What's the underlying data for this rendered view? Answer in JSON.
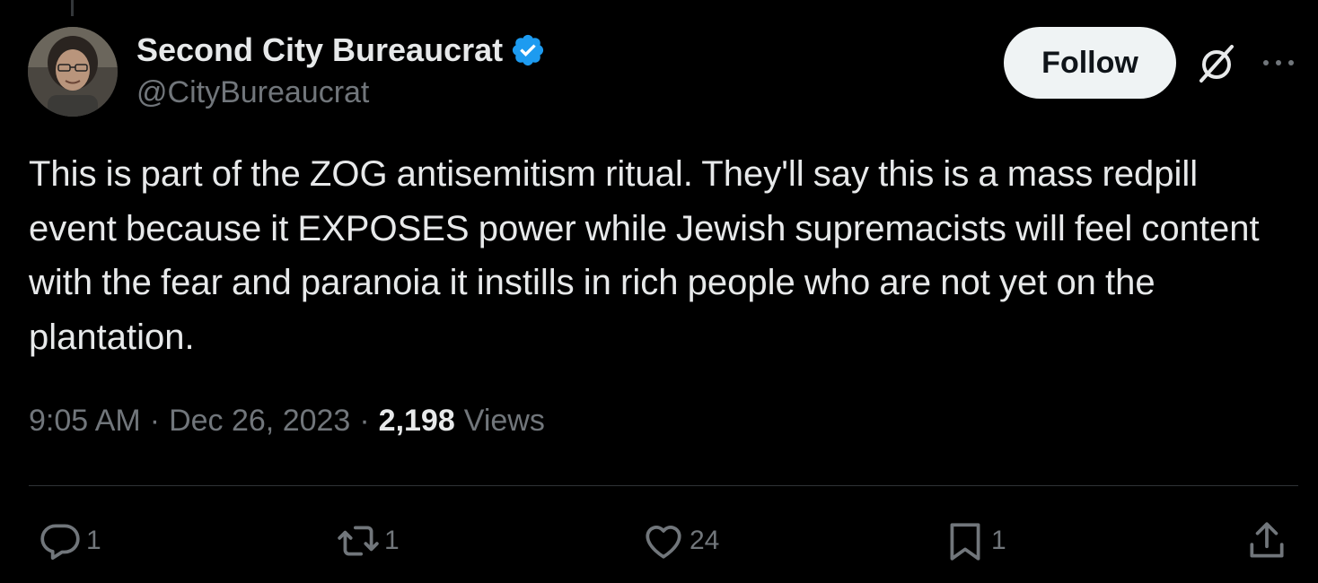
{
  "user": {
    "display_name": "Second City Bureaucrat",
    "handle": "@CityBureaucrat",
    "verified": true,
    "avatar_icon": "profile-photo"
  },
  "header": {
    "follow_label": "Follow",
    "grok_icon": "grok-slash-icon",
    "more_icon": "ellipsis-icon"
  },
  "tweet": {
    "text": "This is part of the ZOG antisemitism ritual. They'll say this is a mass redpill event because it EXPOSES power while Jewish supremacists will feel content with the fear and paranoia it instills in rich people who are not yet on the plantation."
  },
  "meta": {
    "time": "9:05 AM",
    "separator": "·",
    "date": "Dec 26, 2023",
    "views_count": "2,198",
    "views_label": "Views"
  },
  "actions": {
    "reply_count": "1",
    "retweet_count": "1",
    "like_count": "24",
    "bookmark_count": "1"
  },
  "colors": {
    "background": "#000000",
    "text": "#e7e9ea",
    "muted": "#71767b",
    "verified": "#1d9bf0",
    "follow_bg": "#eff3f4"
  }
}
